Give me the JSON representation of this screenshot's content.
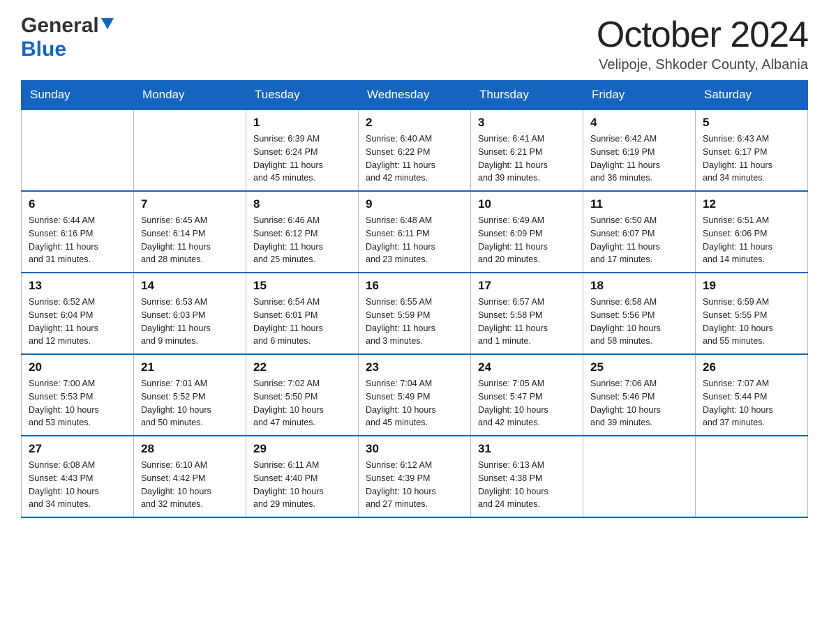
{
  "header": {
    "logo_general": "General",
    "logo_blue": "Blue",
    "month_title": "October 2024",
    "subtitle": "Velipoje, Shkoder County, Albania"
  },
  "weekdays": [
    "Sunday",
    "Monday",
    "Tuesday",
    "Wednesday",
    "Thursday",
    "Friday",
    "Saturday"
  ],
  "weeks": [
    [
      {
        "day": "",
        "info": ""
      },
      {
        "day": "",
        "info": ""
      },
      {
        "day": "1",
        "info": "Sunrise: 6:39 AM\nSunset: 6:24 PM\nDaylight: 11 hours\nand 45 minutes."
      },
      {
        "day": "2",
        "info": "Sunrise: 6:40 AM\nSunset: 6:22 PM\nDaylight: 11 hours\nand 42 minutes."
      },
      {
        "day": "3",
        "info": "Sunrise: 6:41 AM\nSunset: 6:21 PM\nDaylight: 11 hours\nand 39 minutes."
      },
      {
        "day": "4",
        "info": "Sunrise: 6:42 AM\nSunset: 6:19 PM\nDaylight: 11 hours\nand 36 minutes."
      },
      {
        "day": "5",
        "info": "Sunrise: 6:43 AM\nSunset: 6:17 PM\nDaylight: 11 hours\nand 34 minutes."
      }
    ],
    [
      {
        "day": "6",
        "info": "Sunrise: 6:44 AM\nSunset: 6:16 PM\nDaylight: 11 hours\nand 31 minutes."
      },
      {
        "day": "7",
        "info": "Sunrise: 6:45 AM\nSunset: 6:14 PM\nDaylight: 11 hours\nand 28 minutes."
      },
      {
        "day": "8",
        "info": "Sunrise: 6:46 AM\nSunset: 6:12 PM\nDaylight: 11 hours\nand 25 minutes."
      },
      {
        "day": "9",
        "info": "Sunrise: 6:48 AM\nSunset: 6:11 PM\nDaylight: 11 hours\nand 23 minutes."
      },
      {
        "day": "10",
        "info": "Sunrise: 6:49 AM\nSunset: 6:09 PM\nDaylight: 11 hours\nand 20 minutes."
      },
      {
        "day": "11",
        "info": "Sunrise: 6:50 AM\nSunset: 6:07 PM\nDaylight: 11 hours\nand 17 minutes."
      },
      {
        "day": "12",
        "info": "Sunrise: 6:51 AM\nSunset: 6:06 PM\nDaylight: 11 hours\nand 14 minutes."
      }
    ],
    [
      {
        "day": "13",
        "info": "Sunrise: 6:52 AM\nSunset: 6:04 PM\nDaylight: 11 hours\nand 12 minutes."
      },
      {
        "day": "14",
        "info": "Sunrise: 6:53 AM\nSunset: 6:03 PM\nDaylight: 11 hours\nand 9 minutes."
      },
      {
        "day": "15",
        "info": "Sunrise: 6:54 AM\nSunset: 6:01 PM\nDaylight: 11 hours\nand 6 minutes."
      },
      {
        "day": "16",
        "info": "Sunrise: 6:55 AM\nSunset: 5:59 PM\nDaylight: 11 hours\nand 3 minutes."
      },
      {
        "day": "17",
        "info": "Sunrise: 6:57 AM\nSunset: 5:58 PM\nDaylight: 11 hours\nand 1 minute."
      },
      {
        "day": "18",
        "info": "Sunrise: 6:58 AM\nSunset: 5:56 PM\nDaylight: 10 hours\nand 58 minutes."
      },
      {
        "day": "19",
        "info": "Sunrise: 6:59 AM\nSunset: 5:55 PM\nDaylight: 10 hours\nand 55 minutes."
      }
    ],
    [
      {
        "day": "20",
        "info": "Sunrise: 7:00 AM\nSunset: 5:53 PM\nDaylight: 10 hours\nand 53 minutes."
      },
      {
        "day": "21",
        "info": "Sunrise: 7:01 AM\nSunset: 5:52 PM\nDaylight: 10 hours\nand 50 minutes."
      },
      {
        "day": "22",
        "info": "Sunrise: 7:02 AM\nSunset: 5:50 PM\nDaylight: 10 hours\nand 47 minutes."
      },
      {
        "day": "23",
        "info": "Sunrise: 7:04 AM\nSunset: 5:49 PM\nDaylight: 10 hours\nand 45 minutes."
      },
      {
        "day": "24",
        "info": "Sunrise: 7:05 AM\nSunset: 5:47 PM\nDaylight: 10 hours\nand 42 minutes."
      },
      {
        "day": "25",
        "info": "Sunrise: 7:06 AM\nSunset: 5:46 PM\nDaylight: 10 hours\nand 39 minutes."
      },
      {
        "day": "26",
        "info": "Sunrise: 7:07 AM\nSunset: 5:44 PM\nDaylight: 10 hours\nand 37 minutes."
      }
    ],
    [
      {
        "day": "27",
        "info": "Sunrise: 6:08 AM\nSunset: 4:43 PM\nDaylight: 10 hours\nand 34 minutes."
      },
      {
        "day": "28",
        "info": "Sunrise: 6:10 AM\nSunset: 4:42 PM\nDaylight: 10 hours\nand 32 minutes."
      },
      {
        "day": "29",
        "info": "Sunrise: 6:11 AM\nSunset: 4:40 PM\nDaylight: 10 hours\nand 29 minutes."
      },
      {
        "day": "30",
        "info": "Sunrise: 6:12 AM\nSunset: 4:39 PM\nDaylight: 10 hours\nand 27 minutes."
      },
      {
        "day": "31",
        "info": "Sunrise: 6:13 AM\nSunset: 4:38 PM\nDaylight: 10 hours\nand 24 minutes."
      },
      {
        "day": "",
        "info": ""
      },
      {
        "day": "",
        "info": ""
      }
    ]
  ]
}
